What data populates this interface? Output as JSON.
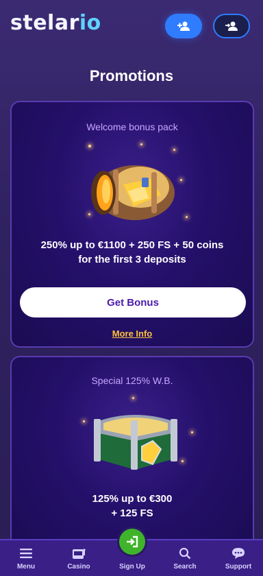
{
  "header": {
    "logo_prefix": "stelar",
    "logo_o": "i",
    "logo_suffix": "o",
    "signup_icon": "add-user-icon",
    "login_icon": "login-user-icon"
  },
  "page": {
    "title": "Promotions"
  },
  "cards": [
    {
      "subtitle": "Welcome bonus pack",
      "text_line1": "250% up to €1100 + 250 FS + 50 coins",
      "text_line2": "for the first 3 deposits",
      "button_label": "Get Bonus",
      "link_label": "More Info",
      "image": "treasure-chest-gold"
    },
    {
      "subtitle": "Special 125% W.B.",
      "text_line1": "125% up to €300",
      "text_line2": "+ 125 FS",
      "image": "treasure-chest-silver"
    }
  ],
  "bottom_nav": [
    {
      "label": "Menu",
      "icon": "menu-icon"
    },
    {
      "label": "Casino",
      "icon": "slot-machine-icon"
    },
    {
      "label": "Sign Up",
      "icon": "sign-in-icon"
    },
    {
      "label": "Search",
      "icon": "search-icon"
    },
    {
      "label": "Support",
      "icon": "chat-icon"
    }
  ],
  "colors": {
    "accent": "#2f7cff",
    "cta_text": "#4a1aa8",
    "link": "#ffc23a",
    "signup_green": "#3fb42a"
  }
}
